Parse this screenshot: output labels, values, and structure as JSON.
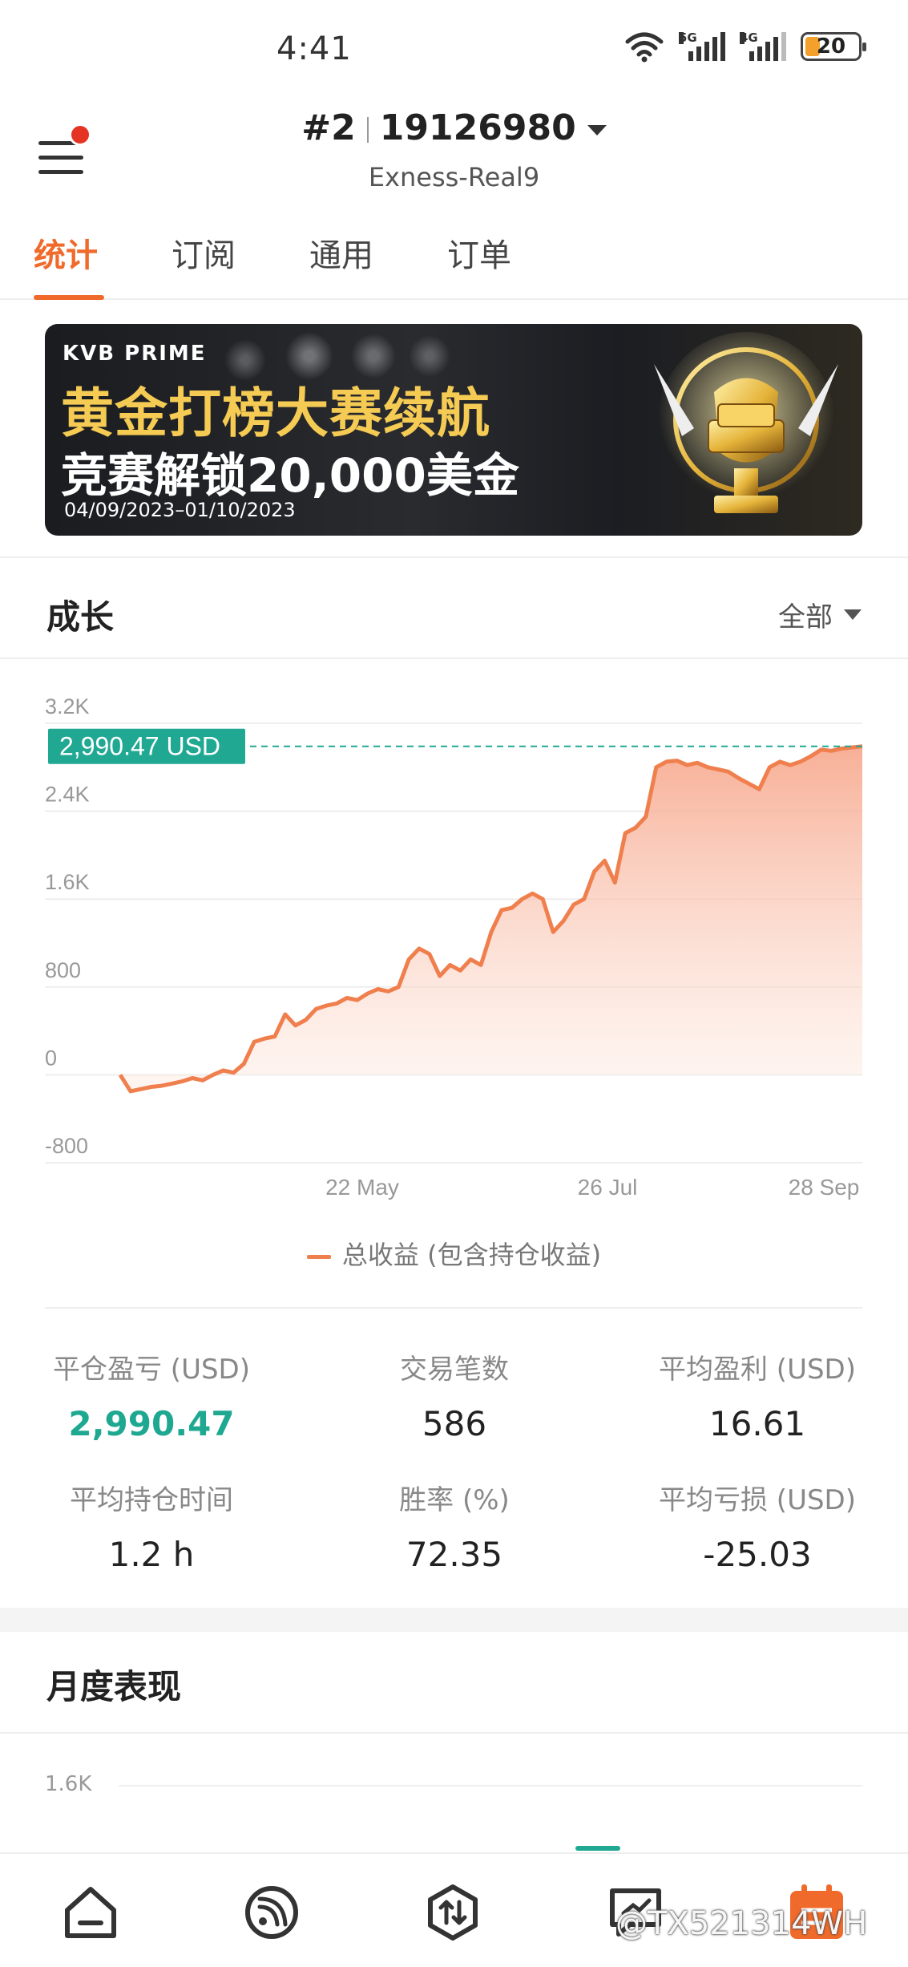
{
  "status_bar": {
    "time": "4:41",
    "battery": "20",
    "net1": "5G",
    "net2": "4G"
  },
  "header": {
    "account_prefix": "#2",
    "account_id": "19126980",
    "server": "Exness-Real9"
  },
  "tabs": [
    {
      "label": "统计",
      "active": true
    },
    {
      "label": "订阅",
      "active": false
    },
    {
      "label": "通用",
      "active": false
    },
    {
      "label": "订单",
      "active": false
    }
  ],
  "banner": {
    "brand": "KVB PRIME",
    "line1": "黄金打榜大赛续航",
    "line2": "竞赛解锁20,000美金",
    "dates": "04/09/2023–01/10/2023"
  },
  "growth": {
    "title": "成长",
    "range": "全部"
  },
  "chart_data": {
    "type": "area",
    "ylim": [
      -800,
      3200
    ],
    "y_ticks": [
      "3.2K",
      "2.4K",
      "1.6K",
      "800",
      "0",
      "-800"
    ],
    "x_ticks": [
      "22 May",
      "26 Jul",
      "28 Sep"
    ],
    "current_value_label": "2,990.47 USD",
    "current_value": 2990.47,
    "series": [
      {
        "name": "总收益 (包含持仓收益)",
        "color": "#f07f4e",
        "values": [
          0,
          -150,
          -130,
          -110,
          -100,
          -80,
          -60,
          -30,
          -50,
          0,
          40,
          20,
          100,
          300,
          330,
          350,
          550,
          450,
          500,
          600,
          630,
          650,
          700,
          680,
          740,
          780,
          760,
          800,
          1050,
          1150,
          1100,
          900,
          1000,
          950,
          1050,
          1000,
          1300,
          1500,
          1520,
          1600,
          1650,
          1600,
          1300,
          1400,
          1550,
          1600,
          1850,
          1950,
          1750,
          2200,
          2250,
          2350,
          2800,
          2850,
          2860,
          2820,
          2840,
          2800,
          2780,
          2760,
          2700,
          2650,
          2600,
          2800,
          2850,
          2820,
          2850,
          2900,
          2960,
          2950,
          2970,
          2980,
          2990.47
        ]
      }
    ]
  },
  "stats": [
    {
      "label": "平仓盈亏 (USD)",
      "value": "2,990.47",
      "highlight": true
    },
    {
      "label": "交易笔数",
      "value": "586"
    },
    {
      "label": "平均盈利 (USD)",
      "value": "16.61"
    },
    {
      "label": "平均持仓时间",
      "value": "1.2 h"
    },
    {
      "label": "胜率 (%)",
      "value": "72.35"
    },
    {
      "label": "平均亏损 (USD)",
      "value": "-25.03"
    }
  ],
  "monthly": {
    "title": "月度表现",
    "tick": "1.6K"
  },
  "bottom_nav": [
    {
      "icon": "home-icon"
    },
    {
      "icon": "signal-icon"
    },
    {
      "icon": "trade-icon"
    },
    {
      "icon": "chat-icon"
    },
    {
      "icon": "calendar-icon"
    }
  ],
  "watermark": "@TX521314WH"
}
